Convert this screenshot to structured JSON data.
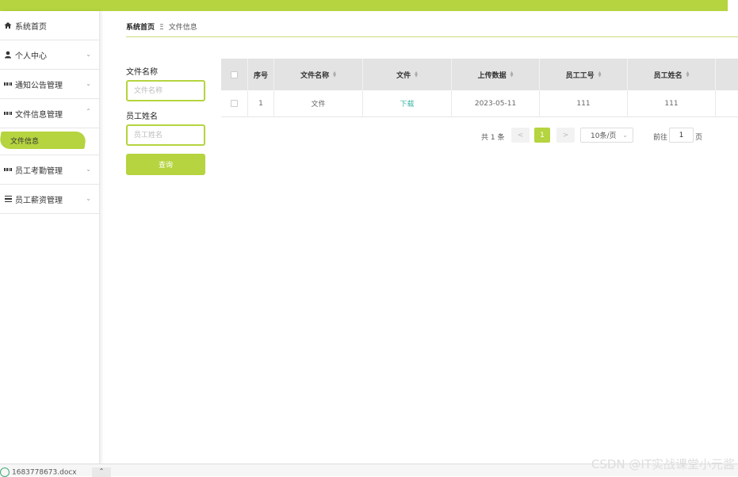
{
  "colors": {
    "accent": "#b5d43f",
    "link": "#3cb3a0"
  },
  "sidebar": {
    "items": [
      {
        "label": "系统首页",
        "icon": "home-icon"
      },
      {
        "label": "个人中心",
        "icon": "user-icon"
      },
      {
        "label": "通知公告管理",
        "icon": "grid-icon"
      },
      {
        "label": "文件信息管理",
        "icon": "grid-icon",
        "expanded": true
      },
      {
        "label": "员工考勤管理",
        "icon": "grid-icon"
      },
      {
        "label": "员工薪资管理",
        "icon": "list-icon"
      }
    ],
    "sub_active": "文件信息"
  },
  "breadcrumb": {
    "home": "系统首页",
    "separator": "Ξ",
    "current": "文件信息"
  },
  "search": {
    "file_name_label": "文件名称",
    "file_name_placeholder": "文件名称",
    "emp_name_label": "员工姓名",
    "emp_name_placeholder": "员工姓名",
    "query_label": "查询"
  },
  "table": {
    "headers": [
      "序号",
      "文件名称",
      "文件",
      "上传数据",
      "员工工号",
      "员工姓名"
    ],
    "rows": [
      {
        "index": "1",
        "file_name": "文件",
        "file": "下载",
        "upload": "2023-05-11",
        "emp_no": "111",
        "emp_name": "111"
      }
    ]
  },
  "pager": {
    "total": "共 1 条",
    "prev": "<",
    "current": "1",
    "next": ">",
    "page_size": "10条/页",
    "goto_label": "前往",
    "goto_value": "1",
    "page_suffix": "页"
  },
  "bottombar": {
    "download_name": "1683778673.docx"
  },
  "watermark": "CSDN @IT实战课堂小元酱"
}
